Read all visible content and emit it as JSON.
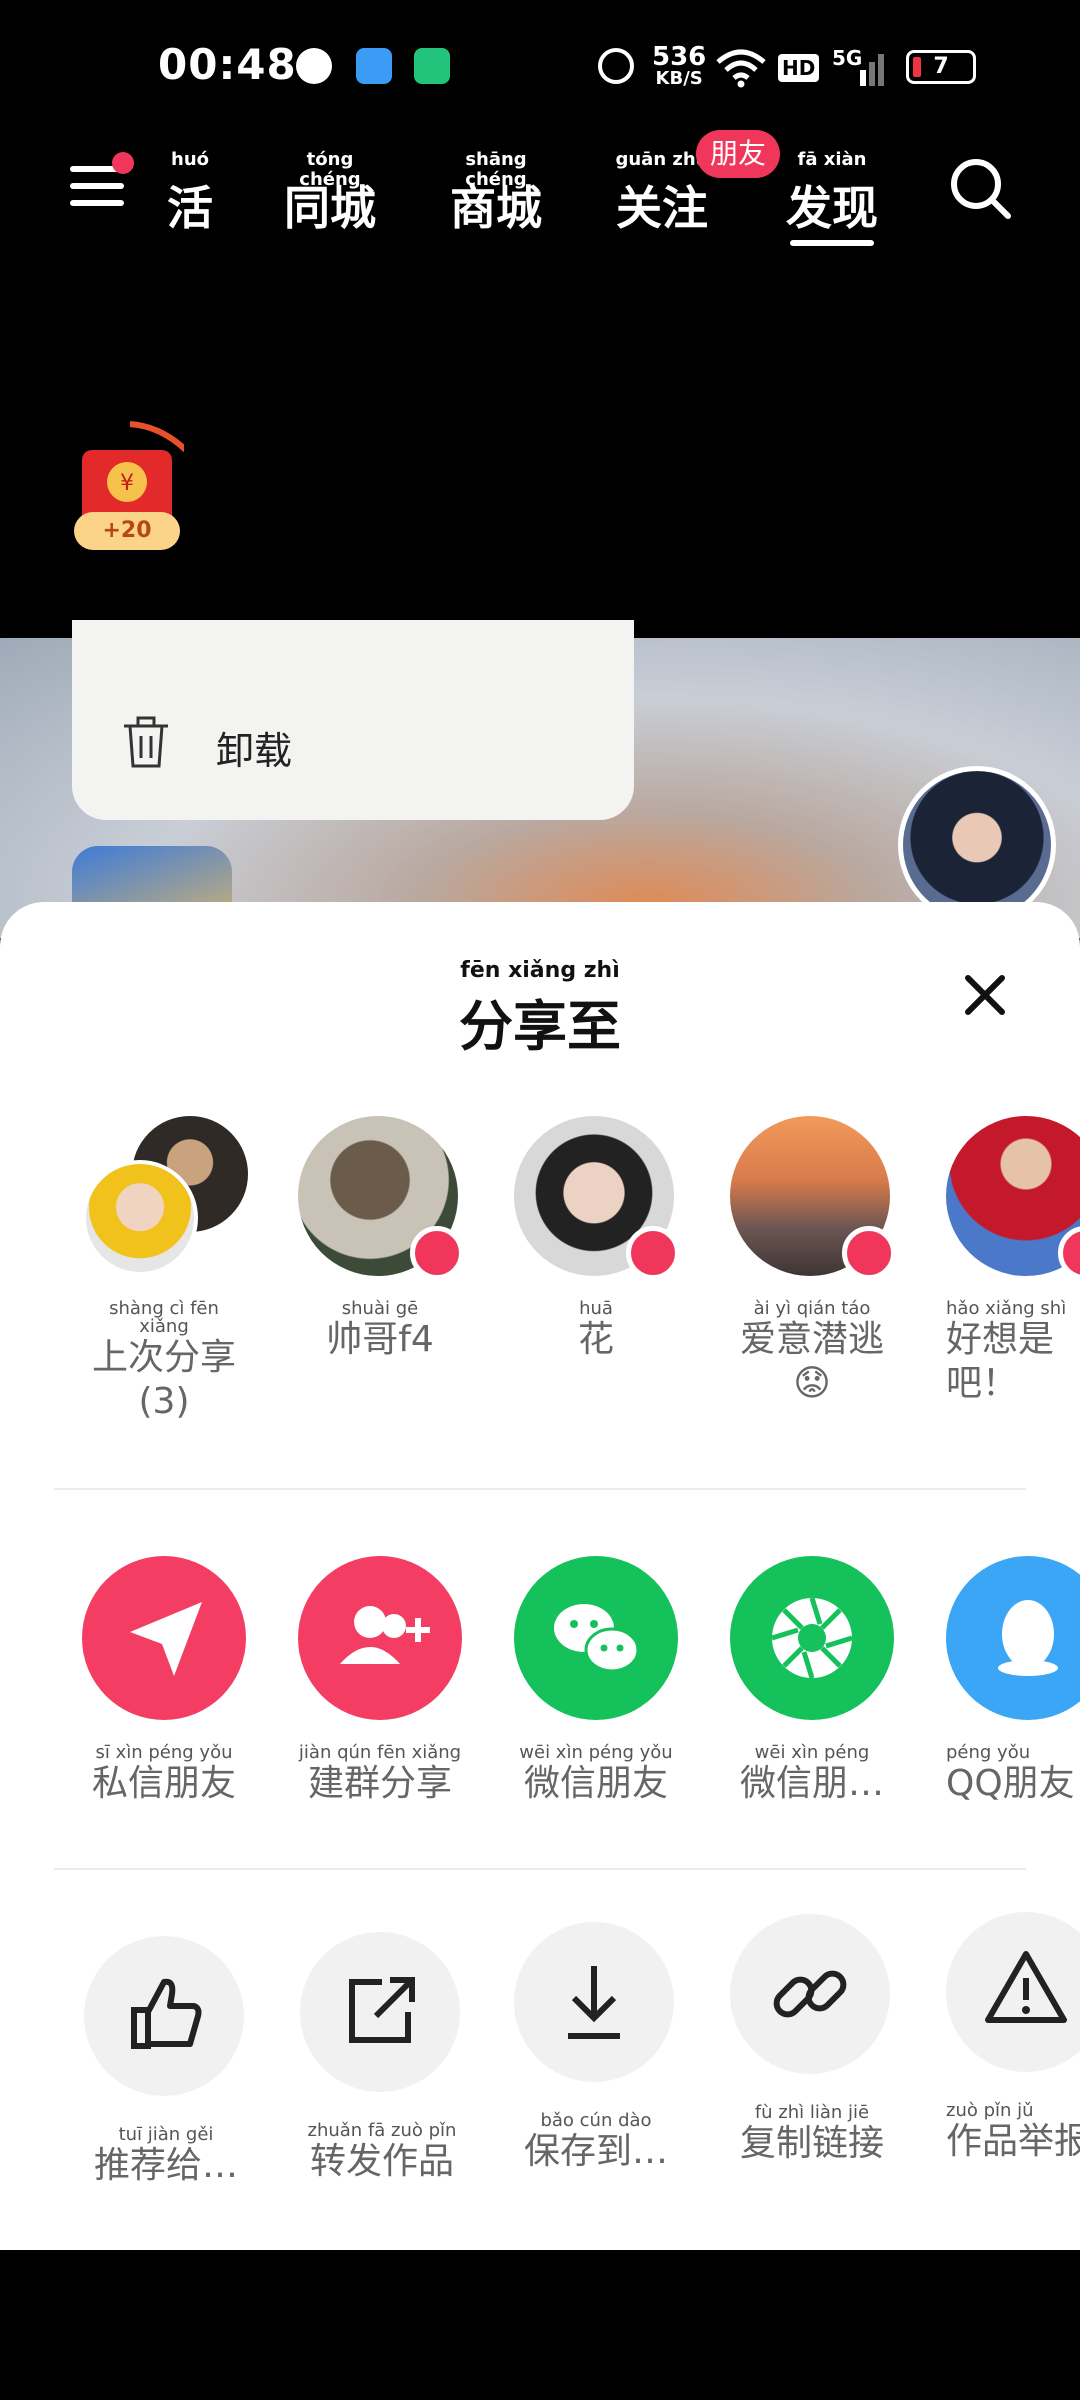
{
  "status_bar": {
    "time": "00:48",
    "speed_value": "536",
    "speed_unit": "KB/S",
    "hd": "HD",
    "network": "5G",
    "battery": "7"
  },
  "top_nav": {
    "items": [
      {
        "label": "活",
        "pinyin": "huó"
      },
      {
        "label": "同城",
        "pinyin": "tóng chéng"
      },
      {
        "label": "商城",
        "pinyin": "shāng chéng"
      },
      {
        "label": "关注",
        "pinyin": "guān zhù"
      },
      {
        "label": "发现",
        "pinyin": "fā xiàn"
      }
    ],
    "active_index": 4,
    "friend_badge": "朋友"
  },
  "red_packet": {
    "reward": "+20"
  },
  "uninstall": {
    "label": "卸载"
  },
  "share_sheet": {
    "title": "分享至",
    "title_pinyin": "fēn xiǎng zhì",
    "contacts": [
      {
        "name": "上次分享",
        "name2": "(3)",
        "pinyin": "shàng cì fēn xiǎng"
      },
      {
        "name": "帅哥f4",
        "name2": "",
        "pinyin": "shuài gē"
      },
      {
        "name": "花",
        "name2": "",
        "pinyin": "huā"
      },
      {
        "name": "爱意潜逃",
        "name2": "😟",
        "pinyin": "ài yì qián táo"
      },
      {
        "name": "好想是",
        "name2": "吧！",
        "pinyin": "hǎo xiǎng shì"
      }
    ],
    "apps": [
      {
        "label": "私信朋友",
        "pinyin": "sī xìn péng yǒu",
        "icon": "send-icon",
        "color": "#f33d63"
      },
      {
        "label": "建群分享",
        "pinyin": "jiàn qún fēn xiǎng",
        "icon": "add-group-icon",
        "color": "#f33d63"
      },
      {
        "label": "微信朋友",
        "pinyin": "wēi xìn péng yǒu",
        "icon": "wechat-icon",
        "color": "#14c15a"
      },
      {
        "label": "微信朋…",
        "pinyin": "wēi xìn péng",
        "icon": "moments-icon",
        "color": "#14c15a"
      },
      {
        "label": "QQ朋友",
        "pinyin": "péng yǒu",
        "icon": "qq-icon",
        "color": "#3aa6f5"
      }
    ],
    "tools": [
      {
        "label": "推荐给…",
        "pinyin": "tuī jiàn gěi",
        "icon": "thumbs-up-icon"
      },
      {
        "label": "转发作品",
        "pinyin": "zhuǎn fā zuò pǐn",
        "icon": "forward-icon"
      },
      {
        "label": "保存到…",
        "pinyin": "bǎo cún dào",
        "icon": "download-icon"
      },
      {
        "label": "复制链接",
        "pinyin": "fù zhì liàn jiē",
        "icon": "link-icon"
      },
      {
        "label": "作品举报",
        "pinyin": "zuò pǐn jǔ",
        "icon": "warning-icon"
      }
    ]
  }
}
